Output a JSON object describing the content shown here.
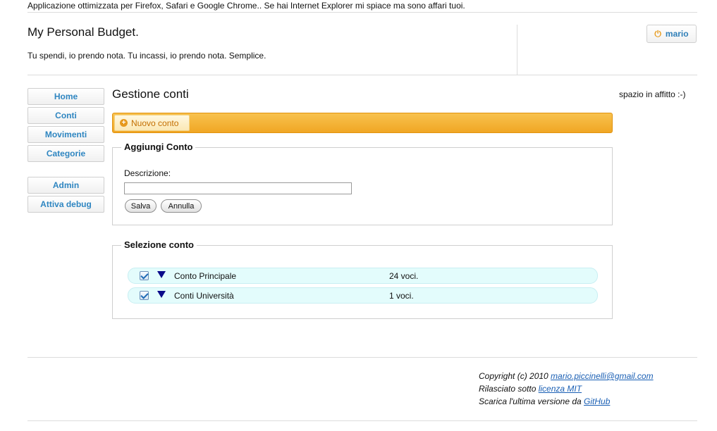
{
  "top_notice": "Applicazione ottimizzata per Firefox, Safari e Google Chrome.. Se hai Internet Explorer mi spiace ma sono affari tuoi.",
  "header": {
    "title": "My Personal Budget.",
    "tagline": "Tu spendi, io prendo nota. Tu incassi, io prendo nota. Semplice.",
    "user_label": "mario",
    "user_icon": "power-icon"
  },
  "nav": {
    "items": [
      "Home",
      "Conti",
      "Movimenti",
      "Categorie"
    ],
    "admin_items": [
      "Admin",
      "Attiva debug"
    ]
  },
  "main": {
    "title": "Gestione conti",
    "new_button": "Nuovo conto",
    "add_form": {
      "legend": "Aggiungi Conto",
      "description_label": "Descrizione:",
      "description_value": "",
      "save_label": "Salva",
      "cancel_label": "Annulla"
    },
    "selection": {
      "legend": "Selezione conto",
      "accounts": [
        {
          "name": "Conto Principale",
          "count": "24 voci."
        },
        {
          "name": "Conti Università",
          "count": "1 voci."
        }
      ]
    }
  },
  "sidebar": {
    "text": "spazio in affitto :-)"
  },
  "footer": {
    "copyright_prefix": "Copyright (c) 2010 ",
    "email": "mario.piccinelli@gmail.com",
    "license_prefix": "Rilasciato sotto ",
    "license_link": "licenza MIT",
    "download_prefix": "Scarica l'ultima versione da ",
    "github_link": "GitHub"
  },
  "colors": {
    "accent_orange": "#f0a624",
    "link_blue": "#2f86c1",
    "row_bg": "#e3fcfc"
  }
}
